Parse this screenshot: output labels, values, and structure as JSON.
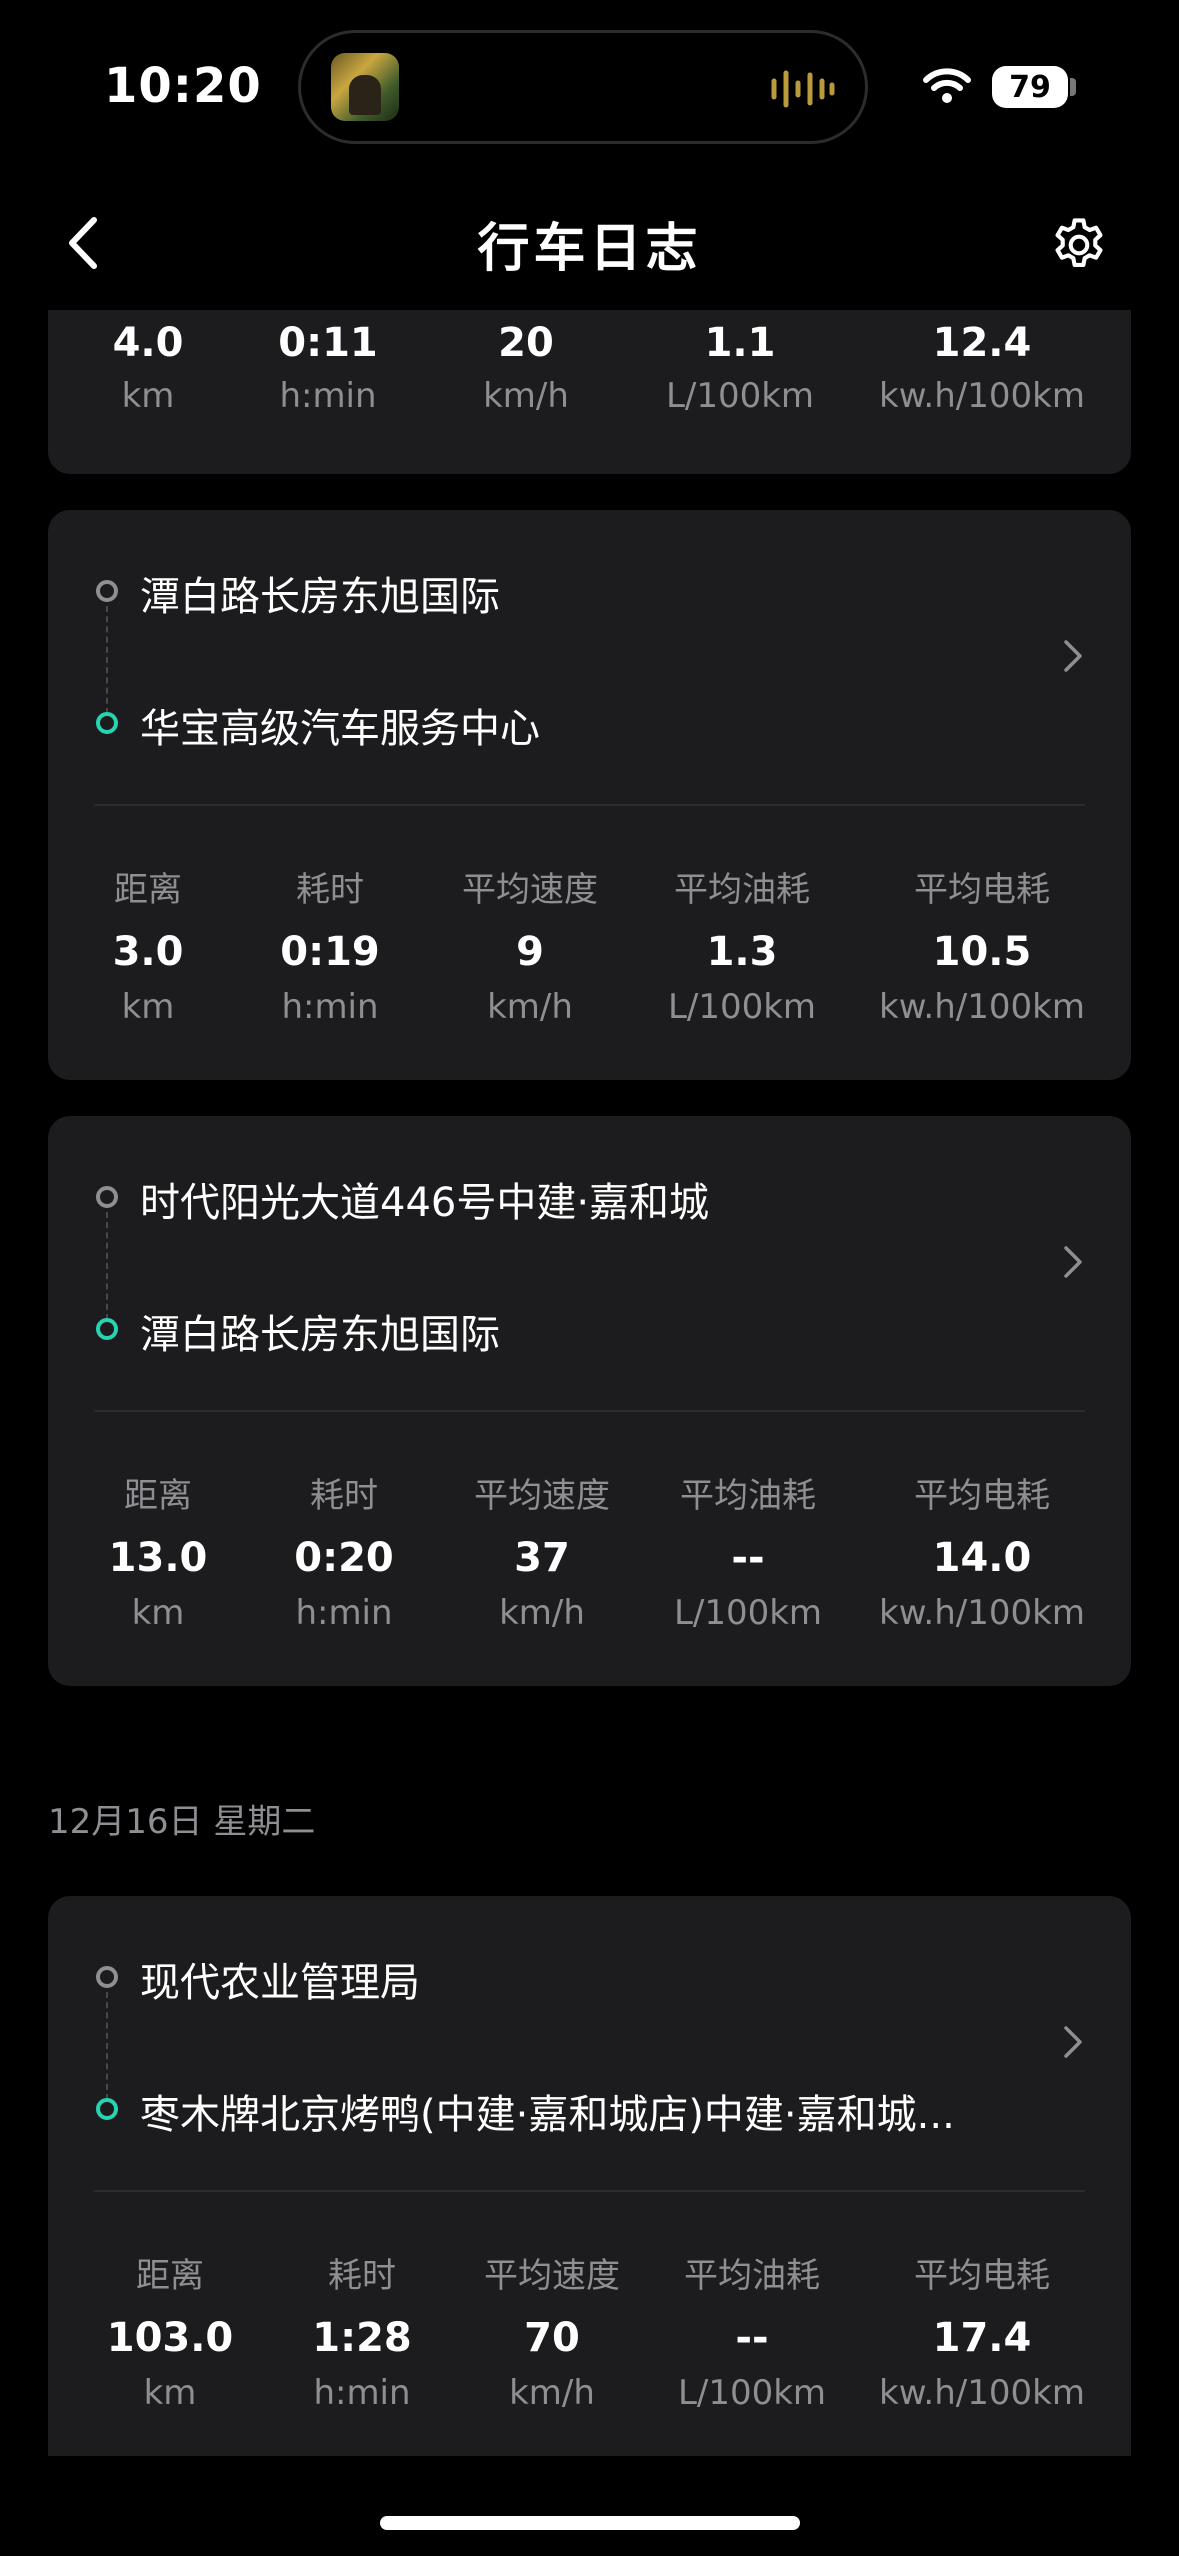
{
  "status_bar": {
    "time": "10:20",
    "battery": "79"
  },
  "nav": {
    "title": "行车日志"
  },
  "top_partial_trip": {
    "values": [
      "4.0",
      "0:11",
      "20",
      "1.1",
      "12.4"
    ],
    "units": [
      "km",
      "h:min",
      "km/h",
      "L/100km",
      "kw.h/100km"
    ]
  },
  "labels": [
    "距离",
    "耗时",
    "平均速度",
    "平均油耗",
    "平均电耗"
  ],
  "trips": [
    {
      "start": "潭白路长房东旭国际",
      "end": "华宝高级汽车服务中心",
      "values": [
        "3.0",
        "0:19",
        "9",
        "1.3",
        "10.5"
      ],
      "units": [
        "km",
        "h:min",
        "km/h",
        "L/100km",
        "kw.h/100km"
      ]
    },
    {
      "start": "时代阳光大道446号中建·嘉和城",
      "end": "潭白路长房东旭国际",
      "values": [
        "13.0",
        "0:20",
        "37",
        "--",
        "14.0"
      ],
      "units": [
        "km",
        "h:min",
        "km/h",
        "L/100km",
        "kw.h/100km"
      ]
    },
    {
      "start": "现代农业管理局",
      "end": "枣木牌北京烤鸭(中建·嘉和城店)中建·嘉和城...",
      "values": [
        "103.0",
        "1:28",
        "70",
        "--",
        "17.4"
      ],
      "units": [
        "km",
        "h:min",
        "km/h",
        "L/100km",
        "kw.h/100km"
      ]
    }
  ],
  "date_header": "12月16日 星期二",
  "colors": {
    "accent": "#27d3b0",
    "card": "#1c1c1e",
    "background": "#000000"
  }
}
